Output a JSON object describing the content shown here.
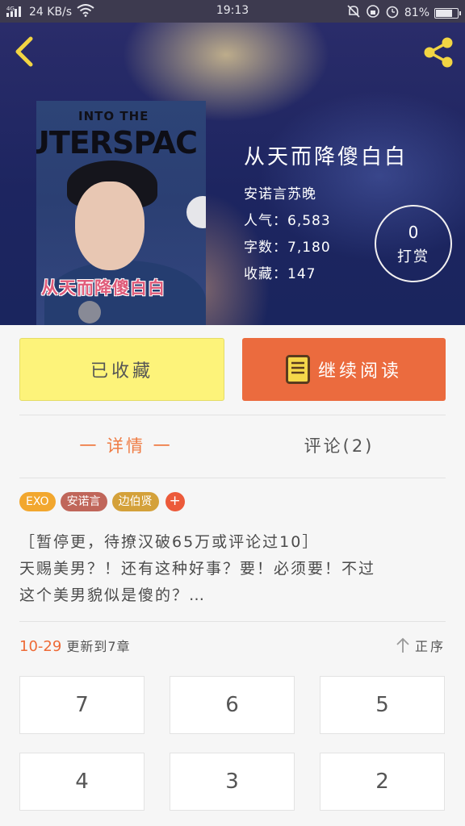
{
  "status_bar": {
    "network": "4G",
    "speed": "24 KB/s",
    "time": "19:13",
    "battery": "81%",
    "battery_level": 0.81
  },
  "book": {
    "title": "从天而降傻白白",
    "author": "安诺言苏晚",
    "popularity": "人气：6,583",
    "word_count": "字数：7,180",
    "favorites": "收藏：147",
    "cover_text_top": "INTO THE",
    "cover_text_main": "UTERSPAC",
    "cover_title": "从天而降傻白白"
  },
  "tip": {
    "count": "0",
    "label": "打赏"
  },
  "actions": {
    "collected_label": "已收藏",
    "continue_label": "继续阅读"
  },
  "tabs": {
    "details": "一 详情 一",
    "comments": "评论(2)"
  },
  "tags": [
    {
      "label": "EXO",
      "color": "#f2a72e"
    },
    {
      "label": "安诺言",
      "color": "#c0665a"
    },
    {
      "label": "边伯贤",
      "color": "#d4a13a"
    }
  ],
  "tag_add_label": "+",
  "description": [
    "［暂停更，待撩汉破65万或评论过10］",
    "天赐美男？！还有这种好事？要！必须要！不过",
    "这个美男貌似是傻的？…"
  ],
  "update": {
    "date": "10-29",
    "text": "更新到7章"
  },
  "order_label": "正序",
  "chapters": [
    "7",
    "6",
    "5",
    "4",
    "3",
    "2"
  ],
  "colors": {
    "accent": "#eb6b3e",
    "collect": "#fdf37a",
    "tab_active": "#ef7b43"
  }
}
